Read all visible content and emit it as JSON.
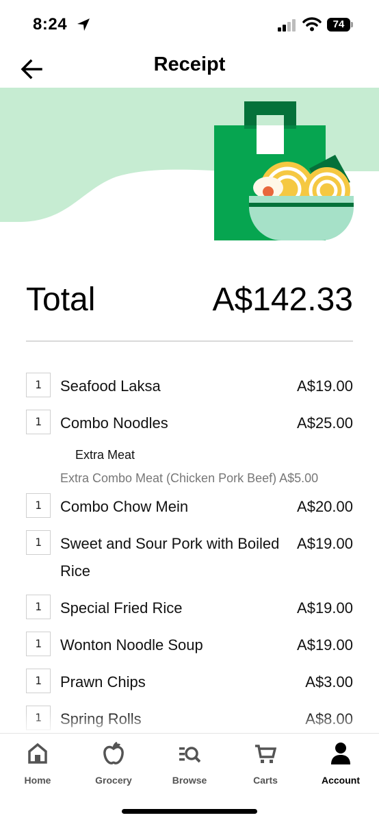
{
  "status_bar": {
    "time": "8:24",
    "battery": "74"
  },
  "header": {
    "title": "Receipt"
  },
  "total": {
    "label": "Total",
    "value": "A$142.33"
  },
  "items": [
    {
      "qty": "1",
      "name": "Seafood Laksa",
      "price": "A$19.00"
    },
    {
      "qty": "1",
      "name": "Combo Noodles",
      "price": "A$25.00",
      "option_group": "Extra Meat",
      "option_line": "Extra Combo Meat (Chicken Pork Beef) A$5.00"
    },
    {
      "qty": "1",
      "name": "Combo Chow Mein",
      "price": "A$20.00"
    },
    {
      "qty": "1",
      "name": "Sweet and Sour Pork with Boiled Rice",
      "price": "A$19.00"
    },
    {
      "qty": "1",
      "name": "Special Fried Rice",
      "price": "A$19.00"
    },
    {
      "qty": "1",
      "name": "Wonton Noodle Soup",
      "price": "A$19.00"
    },
    {
      "qty": "1",
      "name": "Prawn Chips",
      "price": "A$3.00"
    },
    {
      "qty": "1",
      "name": "Spring Rolls",
      "price": "A$8.00"
    }
  ],
  "nav": [
    {
      "label": "Home",
      "icon": "home-icon"
    },
    {
      "label": "Grocery",
      "icon": "apple-icon"
    },
    {
      "label": "Browse",
      "icon": "browse-icon"
    },
    {
      "label": "Carts",
      "icon": "cart-icon"
    },
    {
      "label": "Account",
      "icon": "account-icon",
      "active": true
    }
  ],
  "colors": {
    "brand_green": "#06a550",
    "dark_green": "#05713a",
    "light_green": "#c6ecd2",
    "bowl_mint": "#a6e1c8",
    "noodle_yellow": "#f5c842"
  }
}
